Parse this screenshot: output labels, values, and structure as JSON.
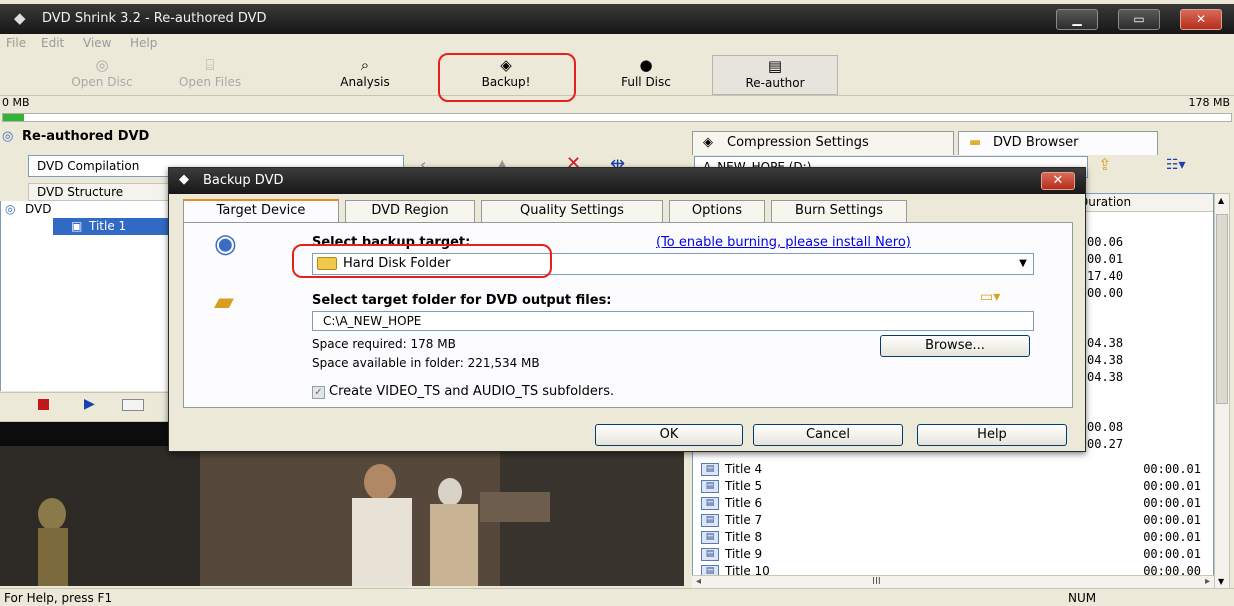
{
  "window": {
    "title": "DVD Shrink 3.2 - Re-authored DVD",
    "minimize_label": "▁",
    "maximize_label": "▭",
    "close_label": "✕"
  },
  "menu": [
    "File",
    "Edit",
    "View",
    "Help"
  ],
  "toolbar": {
    "open_disc": "Open Disc",
    "open_files": "Open Files",
    "analysis": "Analysis",
    "backup": "Backup!",
    "full_disc": "Full Disc",
    "re_author": "Re-author"
  },
  "size_bar": {
    "min_label": "0 MB",
    "max_label": "178 MB",
    "fill_fraction": 0.017
  },
  "left_panel": {
    "title": "Re-authored DVD",
    "compilation_label": "DVD Compilation",
    "structure_header": "DVD Structure",
    "tree": {
      "root": "DVD",
      "child": "Title 1"
    }
  },
  "right_panel": {
    "tabs": {
      "compression": "Compression Settings",
      "browser": "DVD Browser"
    },
    "drive_combo": "A_NEW_HOPE (D:)",
    "duration_header": "Duration",
    "hidden_durations": [
      "00.06",
      "00.01",
      "17.40",
      "00.00",
      "04.38",
      "04.38",
      "04.38",
      "00.08",
      "00.27"
    ],
    "rows": [
      {
        "name": "Title 4",
        "duration": "00:00.01"
      },
      {
        "name": "Title 5",
        "duration": "00:00.01"
      },
      {
        "name": "Title 6",
        "duration": "00:00.01"
      },
      {
        "name": "Title 7",
        "duration": "00:00.01"
      },
      {
        "name": "Title 8",
        "duration": "00:00.01"
      },
      {
        "name": "Title 9",
        "duration": "00:00.01"
      },
      {
        "name": "Title 10",
        "duration": "00:00.00"
      }
    ],
    "hscroll_mark": "III"
  },
  "status": {
    "help_text": "For Help, press F1",
    "num_indicator": "NUM"
  },
  "dialog": {
    "title": "Backup DVD",
    "tabs": [
      "Target Device",
      "DVD Region",
      "Quality Settings",
      "Options",
      "Burn Settings"
    ],
    "select_target_label": "Select backup target:",
    "nero_link": "(To enable burning, please install Nero)",
    "target_value": "Hard Disk Folder",
    "select_folder_label": "Select target folder for DVD output files:",
    "folder_path": "C:\\A_NEW_HOPE",
    "space_required": "Space required:  178 MB",
    "space_available": "Space available in folder:  221,534 MB",
    "browse_label": "Browse...",
    "subfolders_label": "Create VIDEO_TS and AUDIO_TS subfolders.",
    "subfolders_checked": true,
    "ok_label": "OK",
    "cancel_label": "Cancel",
    "help_label": "Help"
  }
}
